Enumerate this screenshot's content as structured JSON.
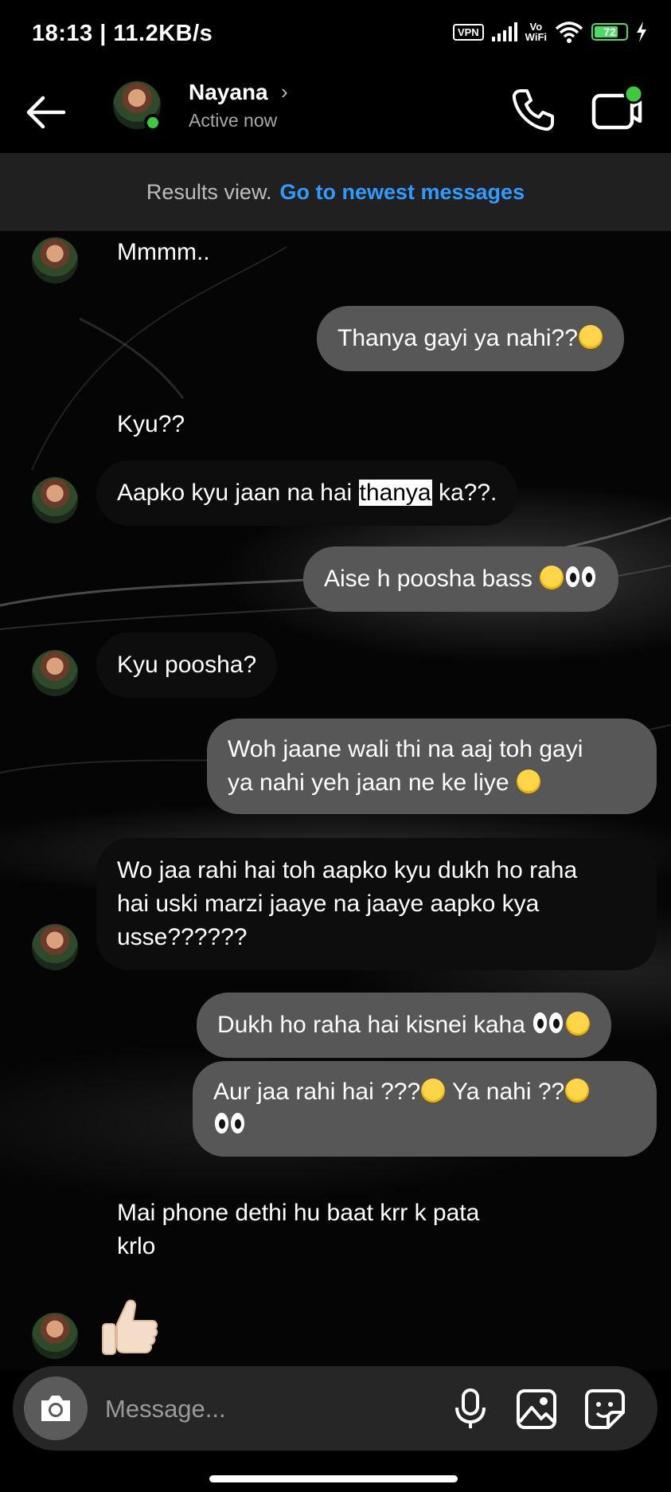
{
  "status_bar": {
    "time_speed": "18:13 | 11.2KB/s",
    "vpn": "VPN",
    "volte": "Vo",
    "wifi_label": "WiFi",
    "battery": "72",
    "icons": [
      "signal-icon",
      "wifi-icon",
      "battery-icon",
      "charging-icon"
    ]
  },
  "header": {
    "name": "Nayana",
    "chevron": "›",
    "status": "Active now",
    "icons": [
      "back-arrow-icon",
      "phone-call-icon",
      "video-call-icon"
    ],
    "online_color": "#3ec93e"
  },
  "banner": {
    "text": "Results view.",
    "link": "Go to newest messages",
    "link_color": "#2f9bff"
  },
  "messages": [
    {
      "from": "them",
      "text": "Mmmm.."
    },
    {
      "from": "me",
      "text": "Thanya gayi ya nahi??",
      "emoji": [
        "sweat-smile"
      ]
    },
    {
      "from": "them",
      "text": "Kyu??"
    },
    {
      "from": "them",
      "pre": "Aapko kyu jaan na hai ",
      "highlight": "thanya",
      "post": " ka??."
    },
    {
      "from": "me",
      "text": "Aise h poosha bass ",
      "emoji": [
        "sweat-smile",
        "eyes"
      ]
    },
    {
      "from": "them",
      "text": "Kyu poosha?"
    },
    {
      "from": "me",
      "line1": "Woh jaane wali thi na aaj toh gayi",
      "line2": "ya nahi yeh jaan ne ke liye ",
      "emoji": [
        "sweat-smile"
      ]
    },
    {
      "from": "them",
      "line1": "Wo jaa rahi hai toh aapko kyu dukh ho raha",
      "line2": "hai uski marzi jaaye na jaaye aapko kya",
      "line3": "usse??????"
    },
    {
      "from": "me",
      "text": "Dukh ho raha hai kisnei kaha ",
      "emoji": [
        "eyes",
        "sweat-smile"
      ]
    },
    {
      "from": "me",
      "part1": "Aur jaa rahi hai ???",
      "part2": " Ya nahi ??",
      "emoji": [
        "sweat-smile",
        "sweat-smile",
        "eyes"
      ]
    },
    {
      "from": "them",
      "line1": "Mai phone dethi hu baat krr k pata",
      "line2": "krlo"
    },
    {
      "from": "them",
      "sticker": "thumbs-up"
    }
  ],
  "composer": {
    "placeholder": "Message...",
    "icons": [
      "camera-icon",
      "microphone-icon",
      "gallery-icon",
      "sticker-icon"
    ]
  },
  "colors": {
    "outgoing_bubble": "#575757",
    "incoming_bubble": "#0d0d0d",
    "banner_bg": "#202020",
    "composer_bg": "#262626"
  }
}
